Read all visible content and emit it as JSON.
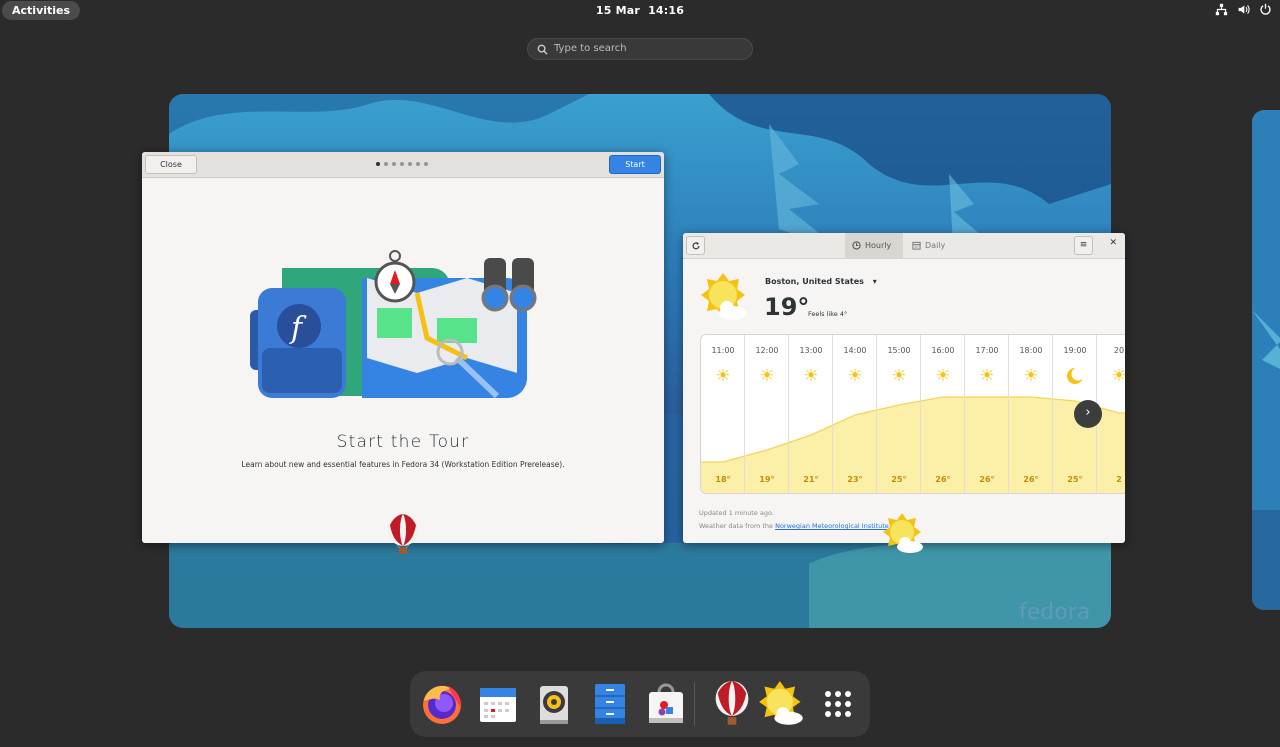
{
  "topbar": {
    "activities_label": "Activities",
    "date": "15 Mar",
    "time": "14:16",
    "icons": [
      "network-icon",
      "volume-icon",
      "power-icon"
    ]
  },
  "search": {
    "placeholder": "Type to search"
  },
  "tour": {
    "close_label": "Close",
    "start_label": "Start",
    "page_count": 7,
    "active_page": 0,
    "title": "Start the Tour",
    "description": "Learn about new and essential features in Fedora 34 (Workstation Edition Prerelease)."
  },
  "weather": {
    "tabs": {
      "hourly": "Hourly",
      "daily": "Daily"
    },
    "location": "Boston, United States",
    "temperature": "19°",
    "feels_like": "Feels like 4°",
    "hours": [
      {
        "time": "11:00",
        "temp": "18°",
        "icon": "sun-icon"
      },
      {
        "time": "12:00",
        "temp": "19°",
        "icon": "sun-icon"
      },
      {
        "time": "13:00",
        "temp": "21°",
        "icon": "sun-icon"
      },
      {
        "time": "14:00",
        "temp": "23°",
        "icon": "sun-icon"
      },
      {
        "time": "15:00",
        "temp": "25°",
        "icon": "sun-icon"
      },
      {
        "time": "16:00",
        "temp": "26°",
        "icon": "sun-icon"
      },
      {
        "time": "17:00",
        "temp": "26°",
        "icon": "sun-icon"
      },
      {
        "time": "18:00",
        "temp": "26°",
        "icon": "sun-icon"
      },
      {
        "time": "19:00",
        "temp": "25°",
        "icon": "moon-icon"
      },
      {
        "time": "20",
        "temp": "2",
        "icon": "sun-icon"
      }
    ],
    "updated": "Updated 1 minute ago.",
    "source_prefix": "Weather data from the",
    "source_link": "Norwegian Meteorological Institute"
  },
  "watermark": "fedora",
  "dash": {
    "apps": [
      "firefox-icon",
      "calendar-icon",
      "rhythmbox-icon",
      "files-icon",
      "software-icon",
      "tour-balloon-icon",
      "weather-icon",
      "app-grid-icon"
    ]
  },
  "colors": {
    "accent": "#3584e4",
    "panel": "#2b2b2b",
    "window": "#f6f5f4"
  }
}
